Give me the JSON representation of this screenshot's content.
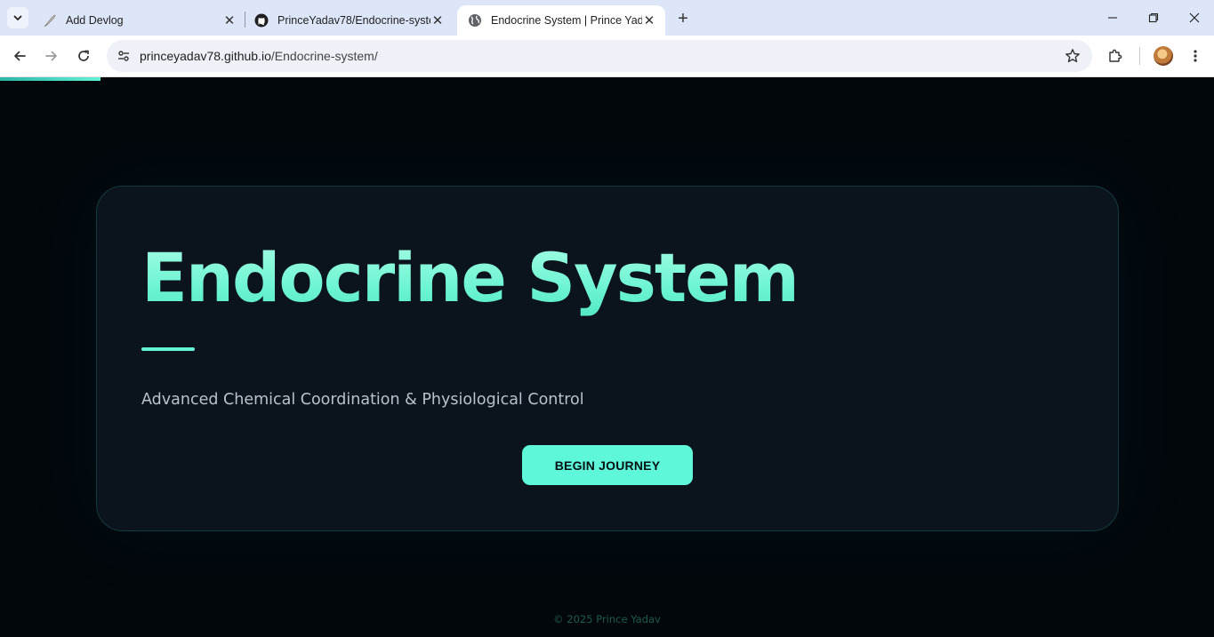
{
  "browser": {
    "tabs": [
      {
        "title": "Add Devlog",
        "favicon": "quill-pen-icon",
        "active": false
      },
      {
        "title": "PrinceYadav78/Endocrine-syste",
        "favicon": "github-icon",
        "active": false
      },
      {
        "title": "Endocrine System | Prince Yada",
        "favicon": "globe-icon",
        "active": true
      }
    ],
    "url": {
      "host": "princeyadav78.github.io",
      "path": "/Endocrine-system/"
    }
  },
  "page": {
    "accent_color": "#5ef7d9",
    "background_color": "#02070c",
    "scroll_progress": 0.083,
    "hero": {
      "title": "Endocrine System",
      "subtitle": "Advanced Chemical Coordination & Physiological Control",
      "cta_label": "BEGIN JOURNEY"
    },
    "footer": "© 2025 Prince Yadav"
  }
}
